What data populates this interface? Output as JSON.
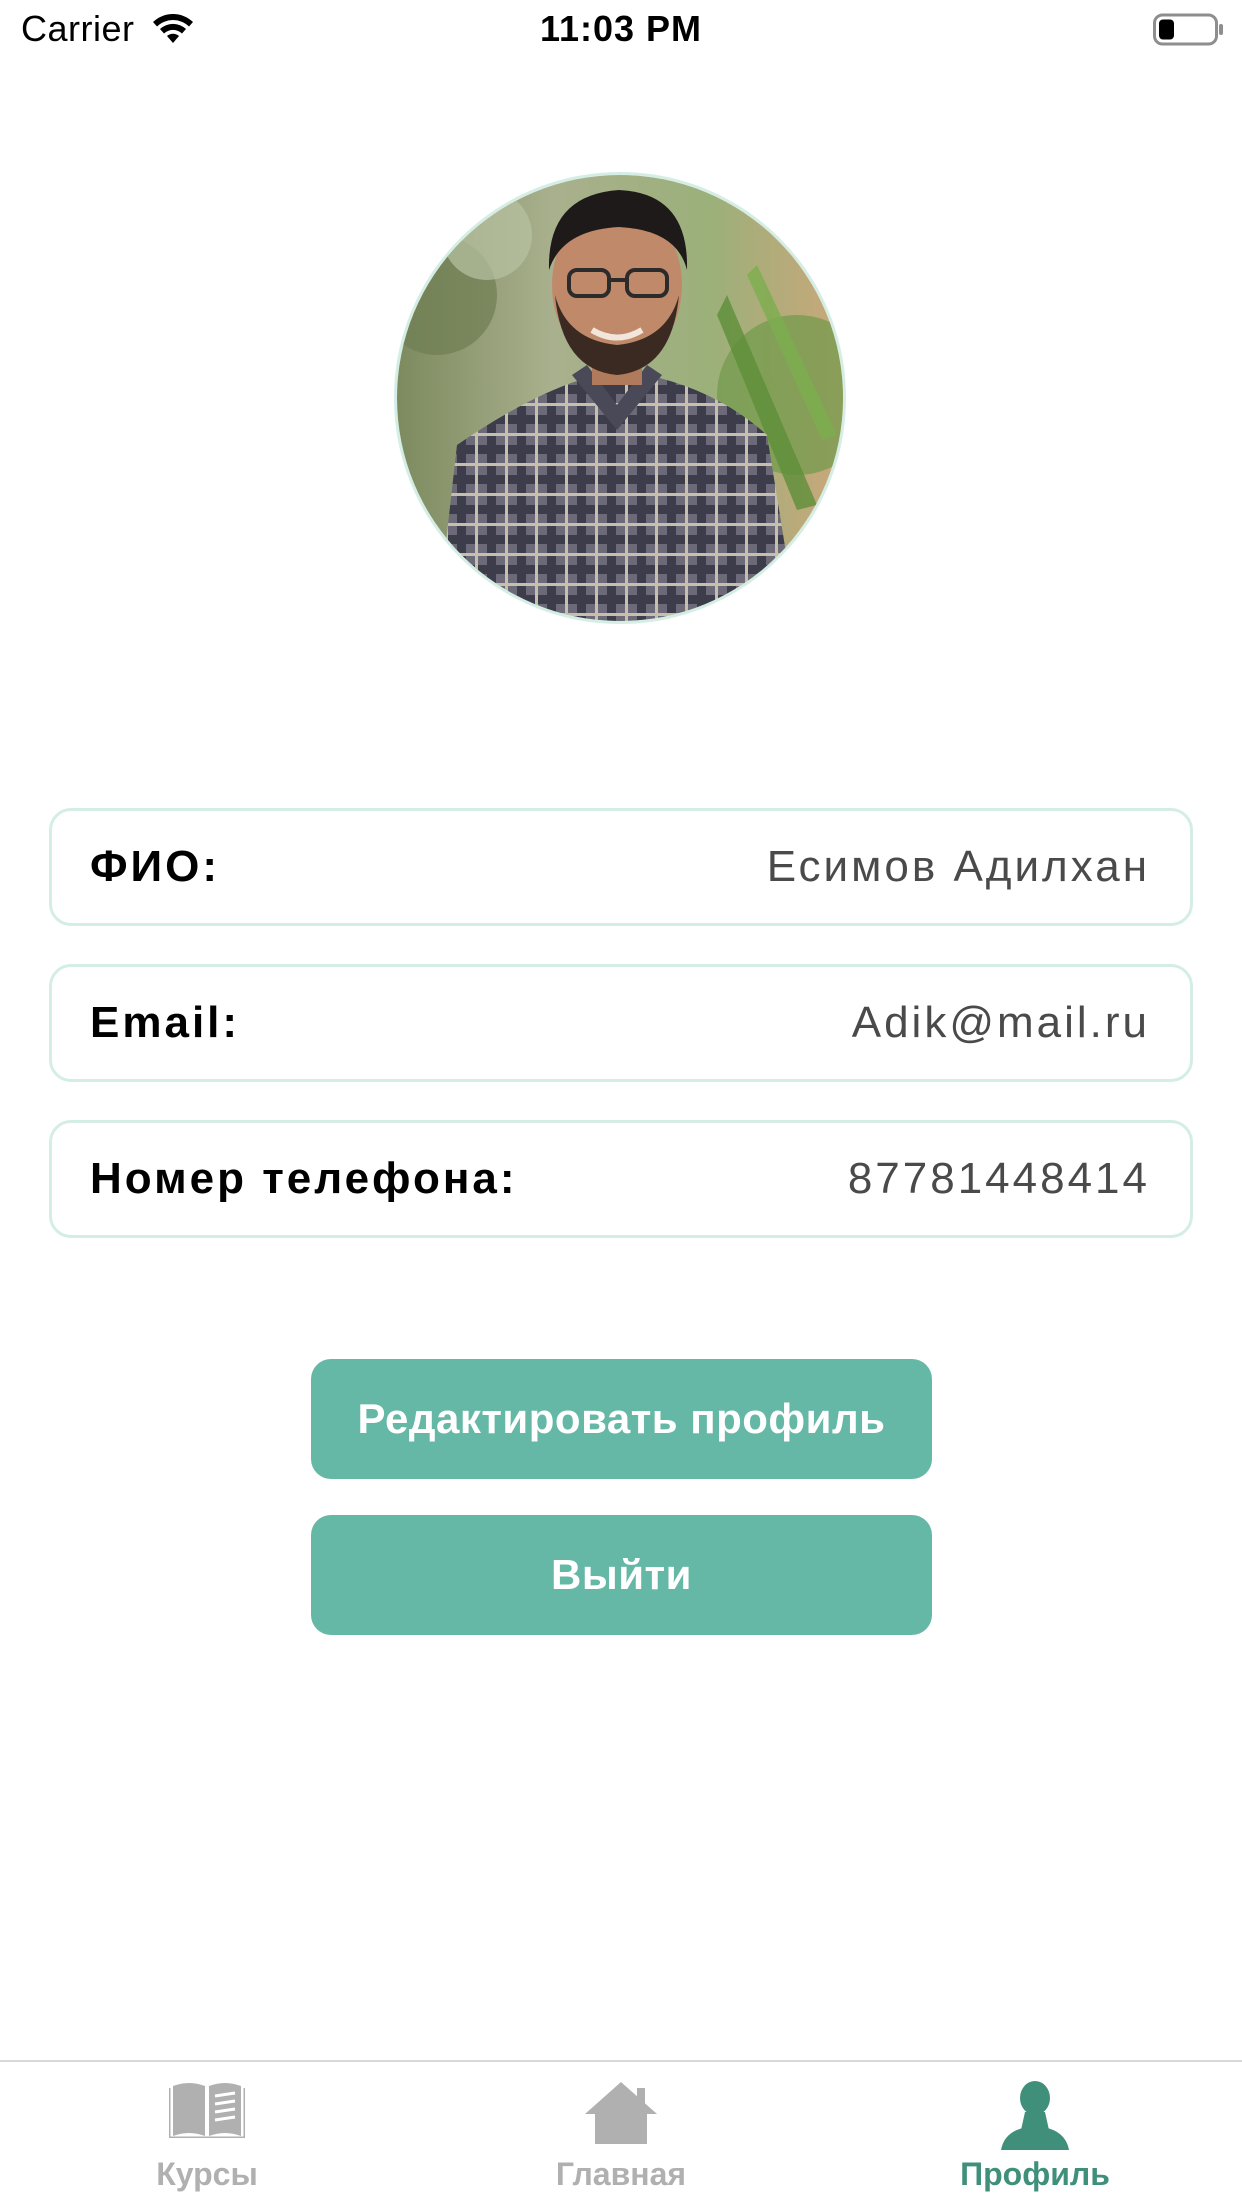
{
  "status_bar": {
    "carrier": "Carrier",
    "time": "11:03 PM",
    "wifi_icon": "wifi-icon",
    "battery_icon": "battery-low-icon"
  },
  "profile": {
    "avatar_icon": "profile-photo",
    "fields": [
      {
        "label": "ФИО:",
        "value": "Есимов Адилхан"
      },
      {
        "label": "Email:",
        "value": "Adik@mail.ru"
      },
      {
        "label": "Номер телефона:",
        "value": "87781448414"
      }
    ]
  },
  "actions": {
    "edit_label": "Редактировать профиль",
    "logout_label": "Выйти"
  },
  "tab_bar": {
    "items": [
      {
        "label": "Курсы",
        "icon": "book-icon",
        "active": false
      },
      {
        "label": "Главная",
        "icon": "home-icon",
        "active": false
      },
      {
        "label": "Профиль",
        "icon": "person-icon",
        "active": true
      }
    ]
  },
  "colors": {
    "accent": "#66b8a6",
    "active_tab": "#3f8f7b",
    "inactive_tab": "#b0b0b0",
    "border": "#d4eee5"
  }
}
